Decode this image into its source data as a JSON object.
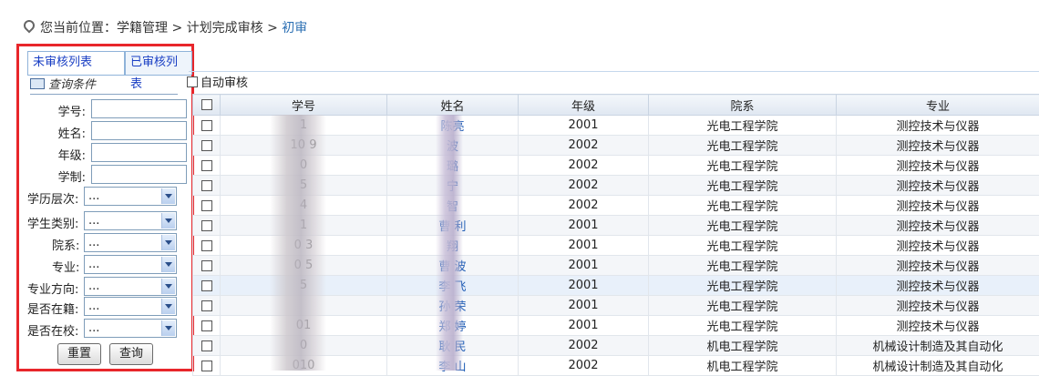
{
  "breadcrumb": {
    "prefix": "您当前位置：",
    "path": [
      "学籍管理",
      "计划完成审核"
    ],
    "current": "初审"
  },
  "tabs": [
    {
      "label": "未审核列表",
      "active": true
    },
    {
      "label": "已审核列表",
      "active": false
    }
  ],
  "query": {
    "title": "查询条件",
    "text_fields": [
      {
        "label": "学号:",
        "value": ""
      },
      {
        "label": "姓名:",
        "value": ""
      },
      {
        "label": "年级:",
        "value": ""
      },
      {
        "label": "学制:",
        "value": ""
      }
    ],
    "select_fields": [
      {
        "label": "学历层次:",
        "value": "..."
      },
      {
        "label": "学生类别:",
        "value": "..."
      },
      {
        "label": "院系:",
        "value": "..."
      },
      {
        "label": "专业:",
        "value": "..."
      },
      {
        "label": "专业方向:",
        "value": "..."
      },
      {
        "label": "是否在籍:",
        "value": "..."
      },
      {
        "label": "是否在校:",
        "value": "..."
      }
    ],
    "reset_label": "重置",
    "search_label": "查询"
  },
  "auto_review_label": "自动审核",
  "table": {
    "columns": [
      "学号",
      "姓名",
      "年级",
      "院系",
      "专业"
    ],
    "rows": [
      {
        "id": "1",
        "name": "陈亮",
        "grade": "2001",
        "dept": "光电工程学院",
        "major": "测控技术与仪器"
      },
      {
        "id": "10 9",
        "name": "波",
        "grade": "2002",
        "dept": "光电工程学院",
        "major": "测控技术与仪器"
      },
      {
        "id": "0",
        "name": "璐",
        "grade": "2002",
        "dept": "光电工程学院",
        "major": "测控技术与仪器"
      },
      {
        "id": "5",
        "name": "宁",
        "grade": "2002",
        "dept": "光电工程学院",
        "major": "测控技术与仪器"
      },
      {
        "id": "4",
        "name": "智",
        "grade": "2002",
        "dept": "光电工程学院",
        "major": "测控技术与仪器"
      },
      {
        "id": "1",
        "name": "曹 利",
        "grade": "2001",
        "dept": "光电工程学院",
        "major": "测控技术与仪器"
      },
      {
        "id": "0 3",
        "name": "翔",
        "grade": "2001",
        "dept": "光电工程学院",
        "major": "测控技术与仪器"
      },
      {
        "id": "0 5",
        "name": "曹 波",
        "grade": "2001",
        "dept": "光电工程学院",
        "major": "测控技术与仪器"
      },
      {
        "id": "5",
        "name": "李 飞",
        "grade": "2001",
        "dept": "光电工程学院",
        "major": "测控技术与仪器"
      },
      {
        "id": "",
        "name": "孙 荣",
        "grade": "2001",
        "dept": "光电工程学院",
        "major": "测控技术与仪器"
      },
      {
        "id": "01",
        "name": "郑 婷",
        "grade": "2001",
        "dept": "光电工程学院",
        "major": "测控技术与仪器"
      },
      {
        "id": "0",
        "name": "耿 民",
        "grade": "2002",
        "dept": "机电工程学院",
        "major": "机械设计制造及其自动化"
      },
      {
        "id": "010",
        "name": "李 山",
        "grade": "2002",
        "dept": "机电工程学院",
        "major": "机械设计制造及其自动化"
      }
    ]
  }
}
